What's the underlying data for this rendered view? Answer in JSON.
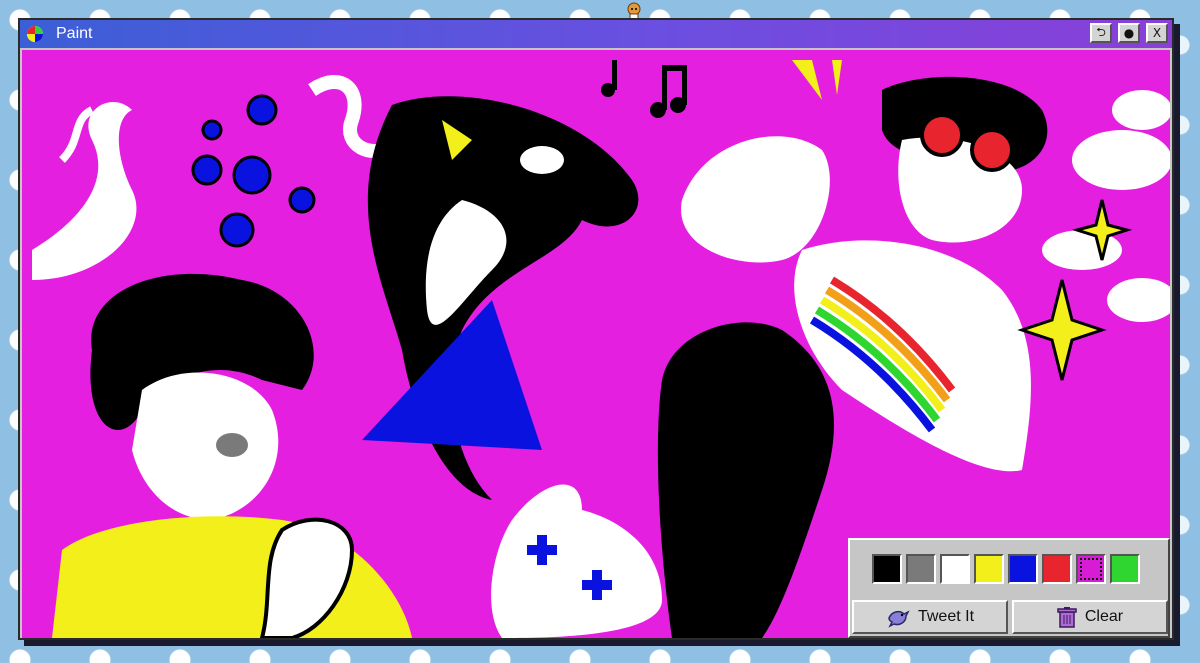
{
  "window": {
    "title": "Paint",
    "controls": [
      {
        "name": "rotate-button",
        "glyph": "⮌"
      },
      {
        "name": "record-button",
        "glyph": "●"
      },
      {
        "name": "close-button",
        "glyph": "X"
      }
    ]
  },
  "artwork": {
    "background_color": "#e51fe0"
  },
  "toolbox": {
    "palette": [
      "#000000",
      "#7a7a7a",
      "#ffffff",
      "#f2ef1a",
      "#0a12e0",
      "#e8252f",
      "#d61cd4",
      "#2fd62f"
    ],
    "selected_index": 6,
    "tweet_label": "Tweet It",
    "clear_label": "Clear"
  },
  "icons": {
    "app": "paint-palette-icon",
    "tweet": "bird-icon",
    "clear": "trash-can-icon"
  }
}
